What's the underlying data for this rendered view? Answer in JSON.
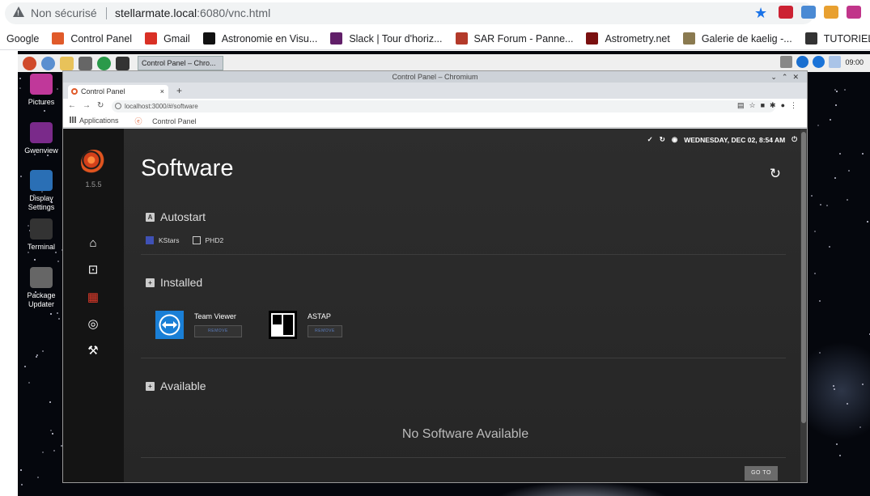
{
  "browser": {
    "security_label": "Non sécurisé",
    "url_host": "stellarmate.local",
    "url_path": ":6080/vnc.html"
  },
  "bookmarks": [
    {
      "label": "Google",
      "icon": "none",
      "color": ""
    },
    {
      "label": "Control Panel",
      "icon": "stellarmate-icon",
      "color": "#e05a2a"
    },
    {
      "label": "Gmail",
      "icon": "gmail-icon",
      "color": "#d93025"
    },
    {
      "label": "Astronomie en Visu...",
      "icon": "spiral-icon",
      "color": "#111111"
    },
    {
      "label": "Slack | Tour d'horiz...",
      "icon": "slack-icon",
      "color": "#611f69"
    },
    {
      "label": "SAR Forum - Panne...",
      "icon": "sar-icon",
      "color": "#b33a2a"
    },
    {
      "label": "Astrometry.net",
      "icon": "astrometry-icon",
      "color": "#7a1010"
    },
    {
      "label": "Galerie de kaelig -...",
      "icon": "gallery-icon",
      "color": "#8a7a50"
    },
    {
      "label": "TUTORIEL -",
      "icon": "tutoriel-icon",
      "color": "#333333"
    }
  ],
  "taskbar": {
    "task_label": "Control Panel – Chro...",
    "clock": "09:00"
  },
  "desktop_icons": [
    {
      "label": "Pictures",
      "color": "#c0389a"
    },
    {
      "label": "Gwenview",
      "color": "#7a2a8a"
    },
    {
      "label": "Display Settings",
      "color": "#2a6fb5"
    },
    {
      "label": "Terminal",
      "color": "#333333"
    },
    {
      "label": "Package Updater",
      "color": "#666666"
    }
  ],
  "inner_window": {
    "title": "Control Panel – Chromium",
    "tab_label": "Control Panel",
    "address": "localhost:3000/#/software",
    "bm_apps": "Applications",
    "bm_control_panel": "Control Panel"
  },
  "app": {
    "version": "1.5.5",
    "status_datetime": "WEDNESDAY, DEC 02, 8:54 AM",
    "page_title": "Software",
    "autostart": {
      "heading": "Autostart",
      "items": [
        {
          "label": "KStars",
          "checked": true
        },
        {
          "label": "PHD2",
          "checked": false
        }
      ]
    },
    "installed": {
      "heading": "Installed",
      "apps": [
        {
          "name": "Team Viewer",
          "remove": "REMOVE"
        },
        {
          "name": "ASTAP",
          "remove": "REMOVE"
        }
      ]
    },
    "available": {
      "heading": "Available",
      "empty_text": "No Software Available"
    },
    "goto_label": "GO TO"
  },
  "colors": {
    "accent_red": "#e03a2a",
    "sidebar_bg": "#141414",
    "main_bg": "#2b2b2b",
    "checkbox_on": "#3f51b5"
  }
}
